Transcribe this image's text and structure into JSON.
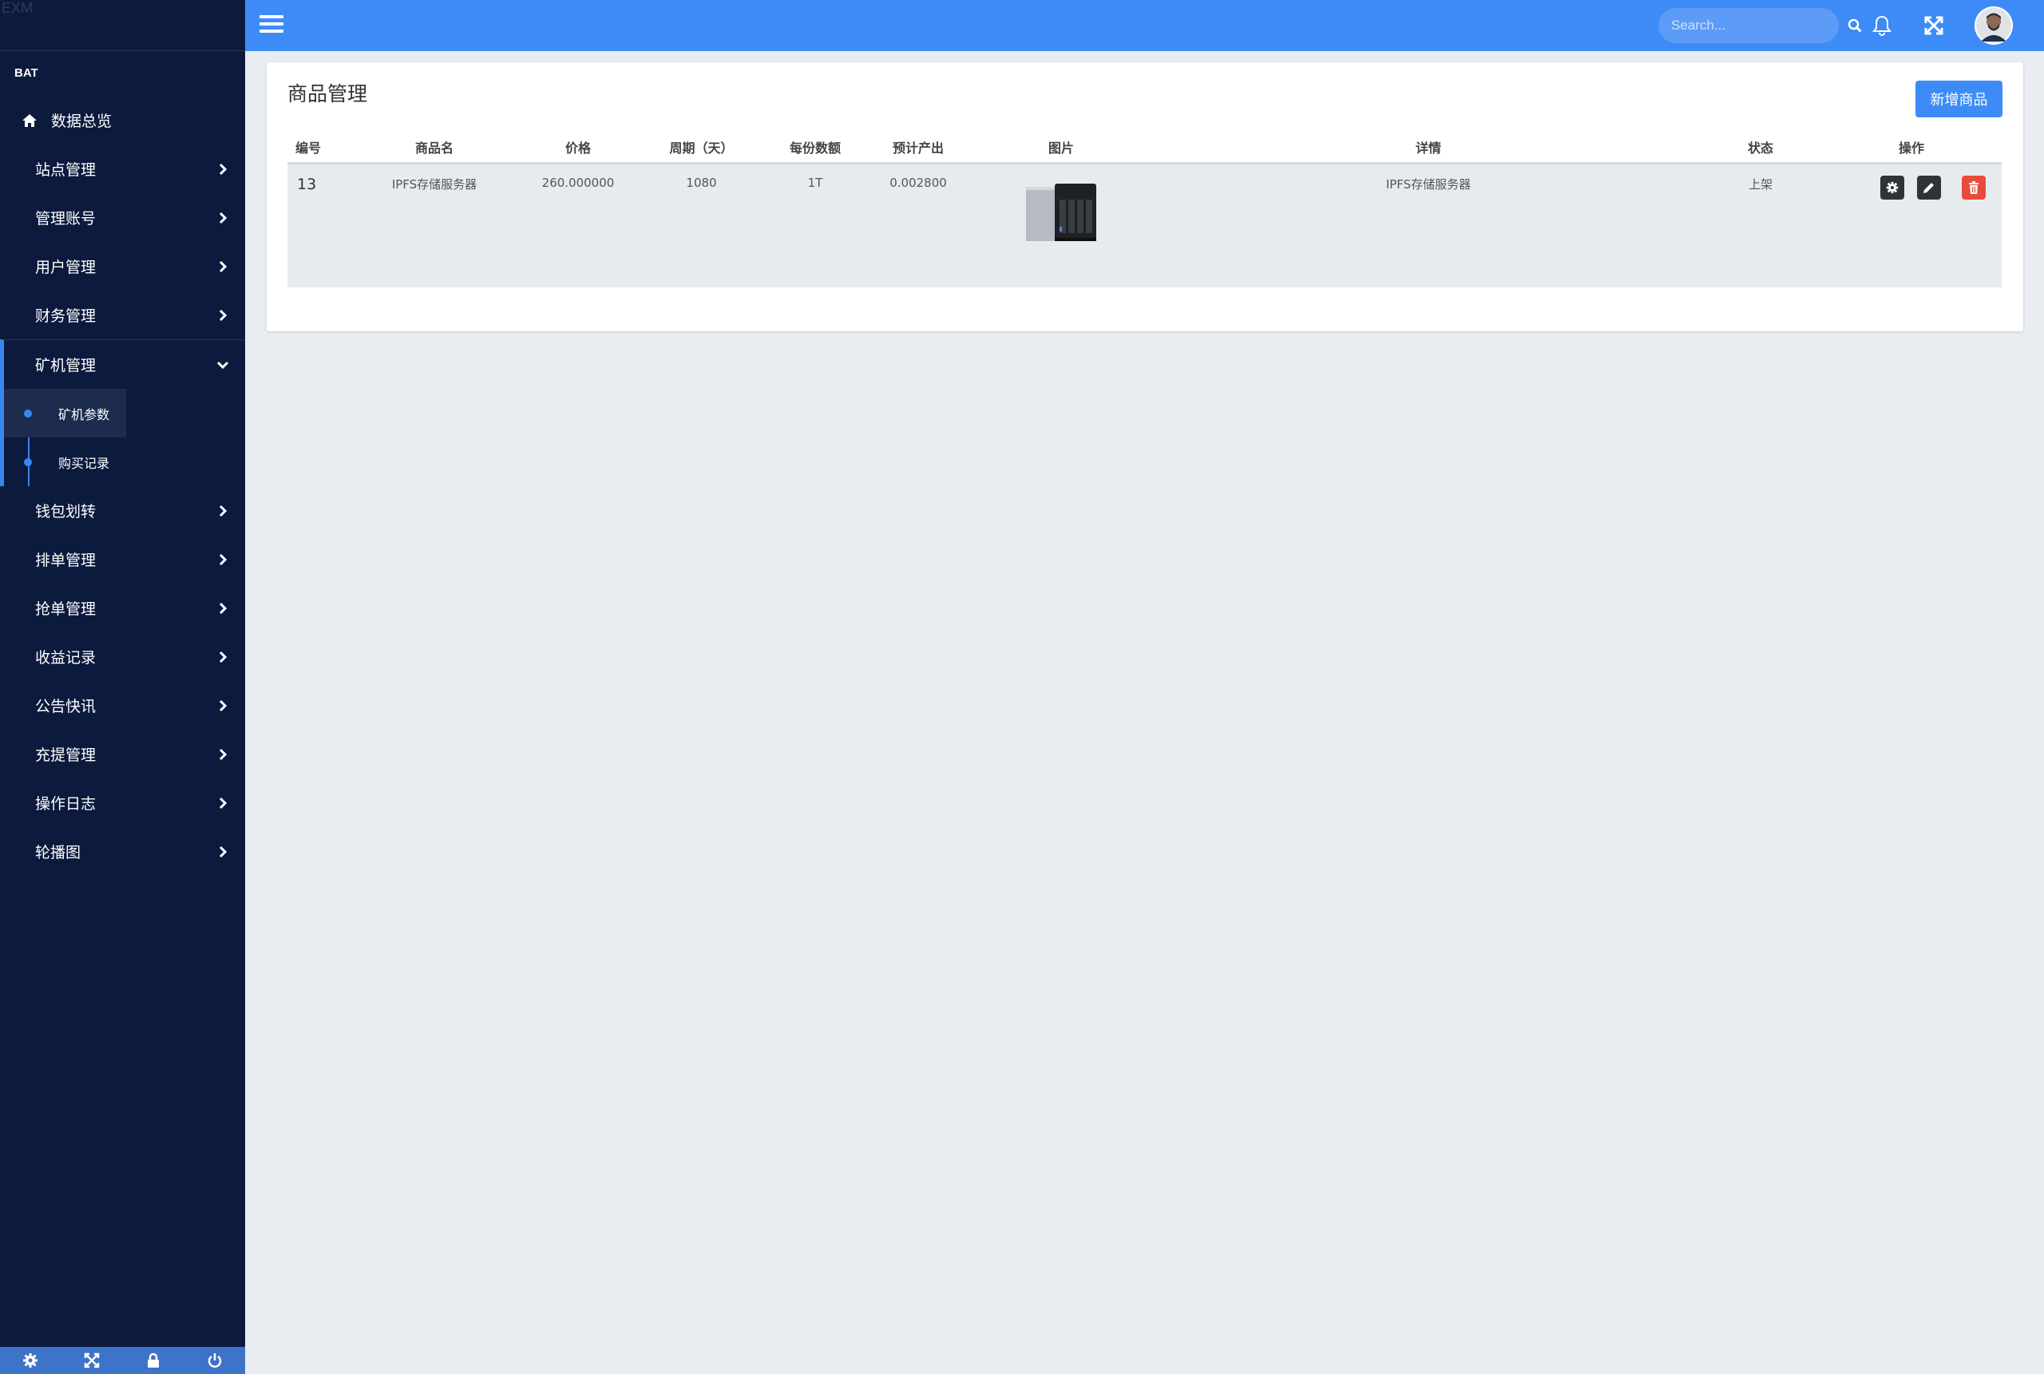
{
  "brand": {
    "logo_text": "EXM",
    "name": "BAT"
  },
  "search": {
    "placeholder": "Search..."
  },
  "sidebar": {
    "home": "数据总览",
    "items": [
      "站点管理",
      "管理账号",
      "用户管理",
      "财务管理"
    ],
    "open_group": {
      "label": "矿机管理",
      "children": [
        "矿机参数",
        "购买记录"
      ]
    },
    "items_after": [
      "钱包划转",
      "排单管理",
      "抢单管理",
      "收益记录",
      "公告快讯",
      "充提管理",
      "操作日志",
      "轮播图"
    ],
    "footer_icons": [
      "gear-icon",
      "expand-icon",
      "lock-icon",
      "power-icon"
    ]
  },
  "page": {
    "title": "商品管理",
    "add_button": "新增商品",
    "columns": [
      "编号",
      "商品名",
      "价格",
      "周期（天）",
      "每份数额",
      "预计产出",
      "图片",
      "详情",
      "状态",
      "操作"
    ],
    "rows": [
      {
        "id": "13",
        "name": "IPFS存储服务器",
        "price": "260.000000",
        "period": "1080",
        "amount": "1T",
        "output": "0.002800",
        "detail": "IPFS存储服务器",
        "status": "上架"
      }
    ]
  },
  "colors": {
    "sidebar_bg": "#0b1a3d",
    "accent": "#3d8bf7",
    "danger": "#e84b3c"
  }
}
